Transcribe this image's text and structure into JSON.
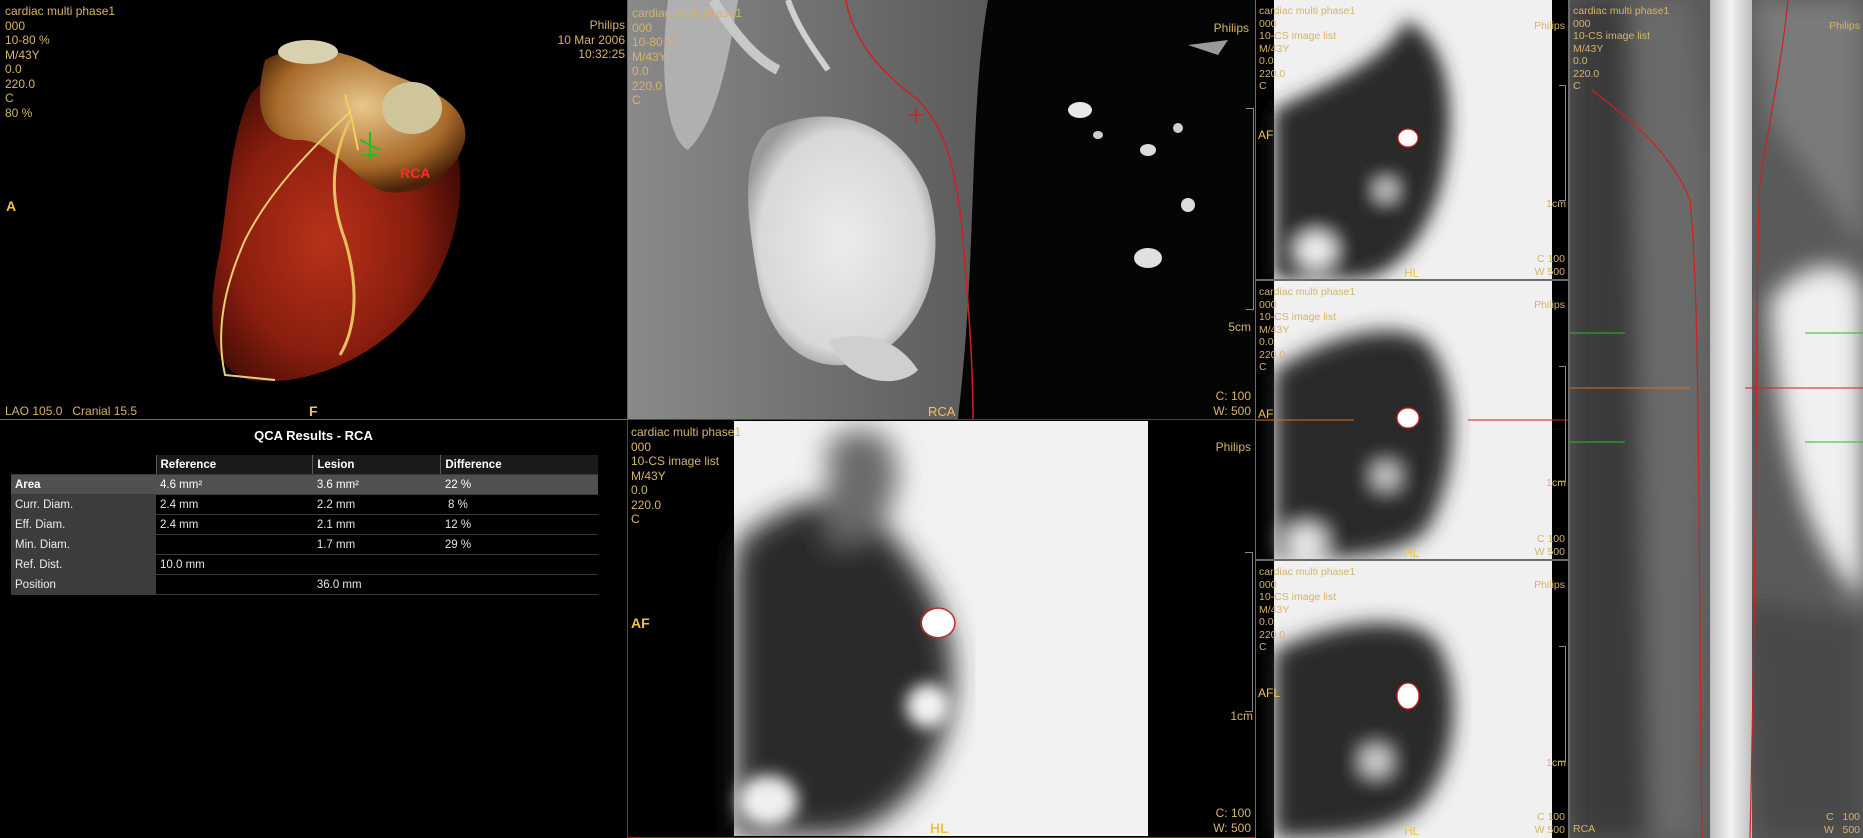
{
  "colors": {
    "overlay": "#d6b46a",
    "orient": "#f0c34a",
    "annotation_red": "#ff2a2a",
    "contour": "#d02020"
  },
  "vr_view": {
    "info": [
      "cardiac multi phase1",
      "000",
      "10-80 %",
      "M/43Y",
      "0.0",
      "220.0",
      "C",
      "80 %"
    ],
    "vendor": "Philips",
    "date": "10 Mar 2006",
    "time": "10:32:25",
    "orient_left": "A",
    "orient_bottom": "F",
    "vessel_label": "RCA",
    "angle": "LAO 105.0   Cranial 15.5"
  },
  "cpr_view": {
    "info": [
      "cardiac multi phase1",
      "000",
      "10-80 %",
      "M/43Y",
      "0.0",
      "220.0",
      "C"
    ],
    "vendor": "Philips",
    "orient_bottom": "RCA",
    "scale": "5cm",
    "c": "C:  100",
    "w": "W:  500"
  },
  "qca": {
    "title": "QCA Results - RCA",
    "headers": [
      "Reference",
      "Lesion",
      "Difference"
    ],
    "rows": [
      {
        "label": "Area",
        "ref": "4.6 mm²",
        "lesion": "3.6 mm²",
        "diff": "22 %"
      },
      {
        "label": "Curr. Diam.",
        "ref": "2.4 mm",
        "lesion": "2.2 mm",
        "diff": " 8 %"
      },
      {
        "label": "Eff. Diam.",
        "ref": "2.4 mm",
        "lesion": "2.1 mm",
        "diff": "12 %"
      },
      {
        "label": "Min. Diam.",
        "ref": "",
        "lesion": "1.7 mm",
        "diff": "29 %"
      },
      {
        "label": "Ref. Dist.",
        "ref": "10.0 mm",
        "lesion": "",
        "diff": ""
      },
      {
        "label": "Position",
        "ref": "",
        "lesion": "36.0 mm",
        "diff": ""
      }
    ]
  },
  "cs_main": {
    "info": [
      "cardiac multi phase1",
      "000",
      "10-CS image list",
      "M/43Y",
      "0.0",
      "220.0",
      "C"
    ],
    "vendor": "Philips",
    "orient_left": "AF",
    "orient_bottom": "HL",
    "scale": "1cm",
    "c": "C:  100",
    "w": "W:  500"
  },
  "cs_small": [
    {
      "info": [
        "cardiac multi phase1",
        "000",
        "10-CS image list",
        "M/43Y",
        "0.0",
        "220.0",
        "C"
      ],
      "vendor": "Philips",
      "orient_left": "AF",
      "orient_bottom": "HL",
      "scale": "1cm",
      "c": "C   100",
      "w": "W  500"
    },
    {
      "info": [
        "cardiac multi phase1",
        "000",
        "10-CS image list",
        "M/43Y",
        "0.0",
        "220.0",
        "C"
      ],
      "vendor": "Philips",
      "orient_left": "AF",
      "orient_bottom": "HL",
      "scale": "1cm",
      "c": "C   100",
      "w": "W  500"
    },
    {
      "info": [
        "cardiac multi phase1",
        "000",
        "10-CS image list",
        "M/43Y",
        "0.0",
        "220.0",
        "C"
      ],
      "vendor": "Philips",
      "orient_left": "AFL",
      "orient_bottom": "HL",
      "scale": "1cm",
      "c": "C   100",
      "w": "W  500"
    }
  ],
  "straight_view": {
    "info": [
      "cardiac multi phase1",
      "000",
      "10-CS image list",
      "M/43Y",
      "0.0",
      "220.0",
      "C"
    ],
    "vendor": "Philips",
    "orient_bottom": "RCA",
    "c": "C   100",
    "w": "W   500"
  }
}
